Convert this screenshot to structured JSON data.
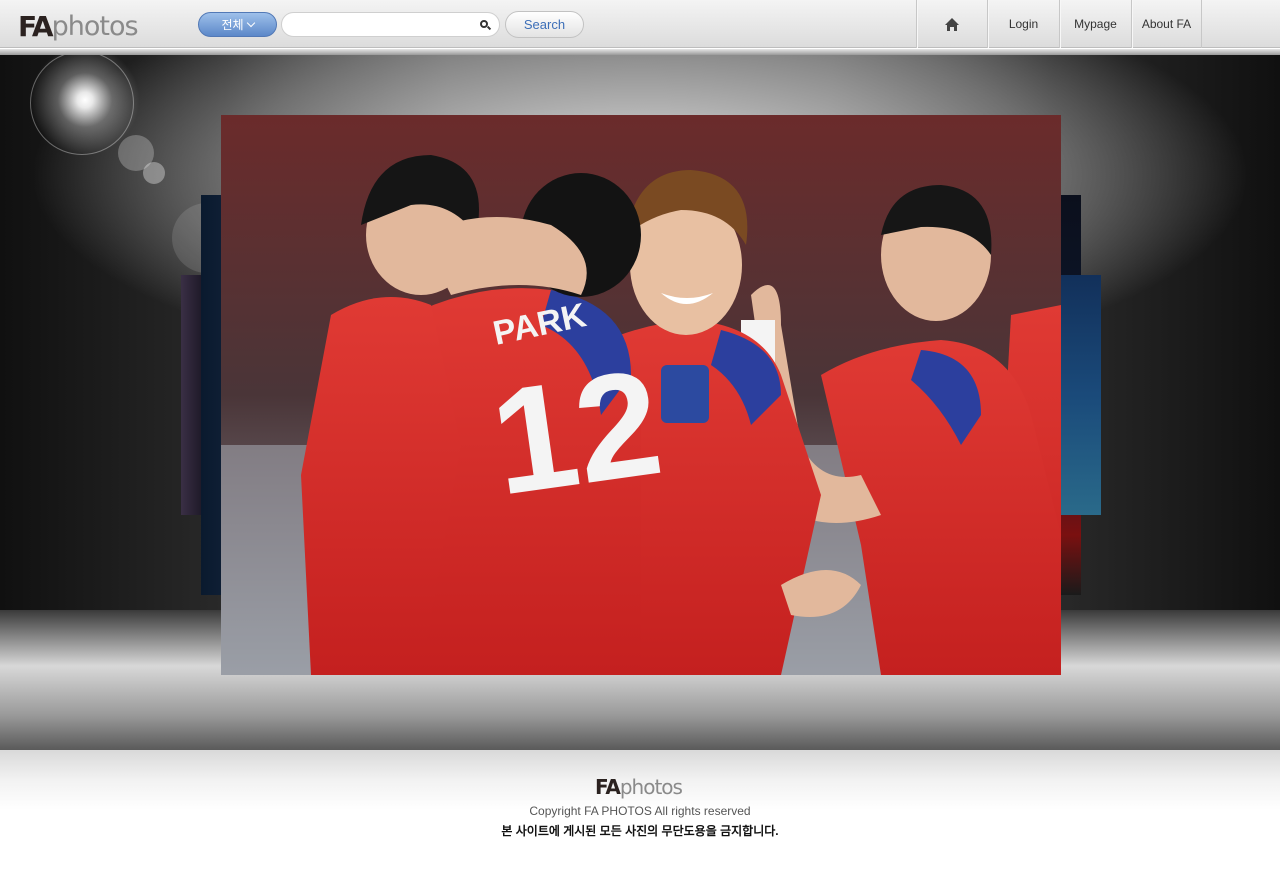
{
  "header": {
    "logo": {
      "bold": "FA",
      "light": "photos"
    },
    "category": {
      "label": "전체"
    },
    "search": {
      "value": "",
      "placeholder": ""
    },
    "search_button": "Search",
    "nav": [
      {
        "label": "",
        "icon": "home-icon"
      },
      {
        "label": "Login"
      },
      {
        "label": "Mypage"
      },
      {
        "label": "About FA"
      }
    ]
  },
  "gallery": {
    "main_photo": {
      "jersey_name": "PARK",
      "jersey_number": "12"
    }
  },
  "footer": {
    "logo": {
      "bold": "FA",
      "light": "photos"
    },
    "copyright": "Copyright FA PHOTOS All rights reserved",
    "notice": "본 사이트에 게시된 모든 사진의 무단도용을 금지합니다."
  },
  "colors": {
    "header_bg": "#e4e4e4",
    "category_button": "#7ba3dc",
    "search_button_text": "#3d6fb8",
    "jersey_red": "#d8312f",
    "jersey_blue": "#2c3f9e"
  }
}
